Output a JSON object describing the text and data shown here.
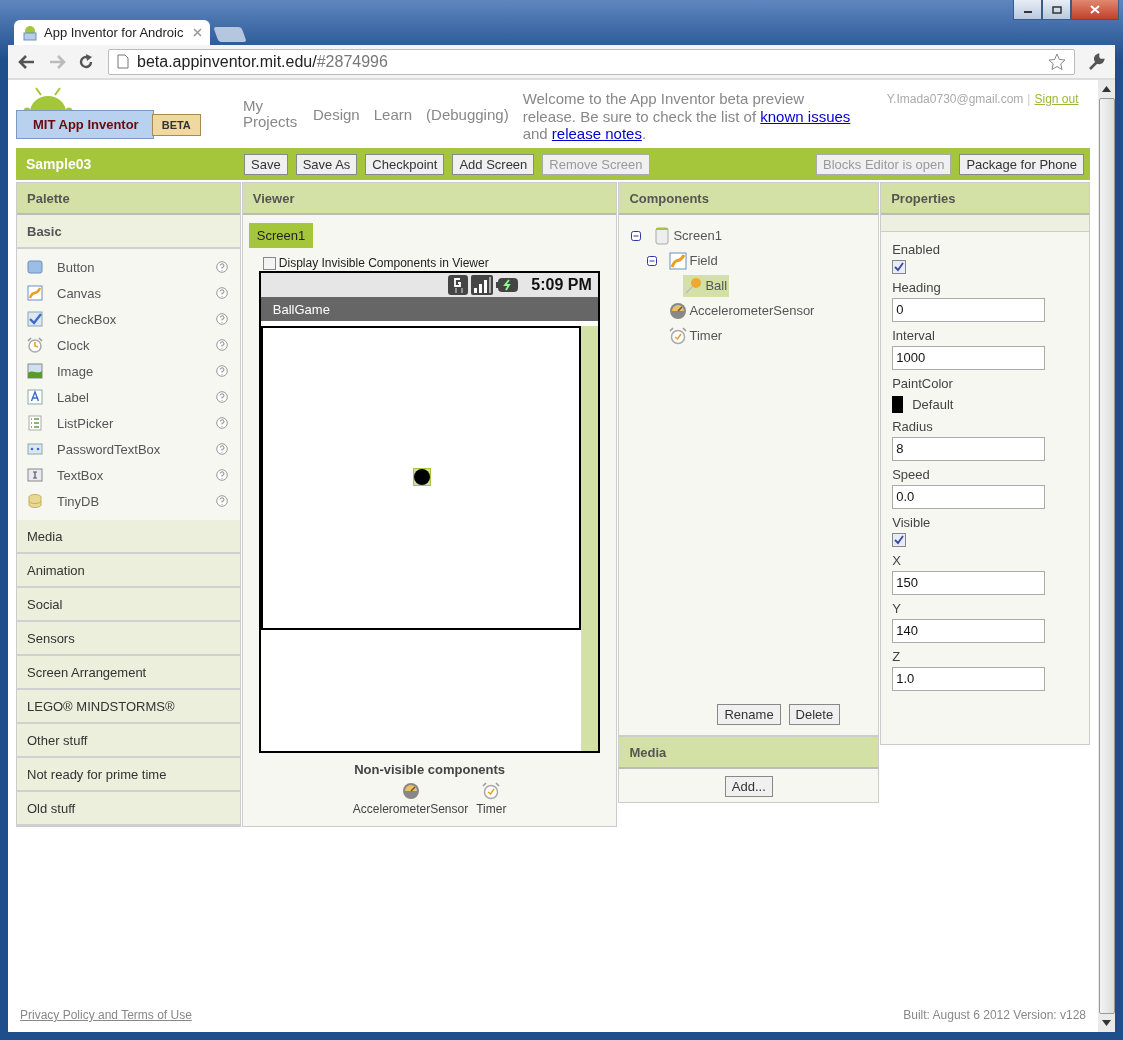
{
  "browser": {
    "tab_title": "App Inventor for Androic",
    "url_host": "beta.appinventor.mit.edu/",
    "url_path": "#2874996"
  },
  "header": {
    "logo": {
      "title": "MIT App Inventor",
      "badge": "BETA"
    },
    "nav": [
      "My Projects",
      "Design",
      "Learn",
      "(Debugging)"
    ],
    "welcome": [
      {
        "kind": "text",
        "text": "Welcome to the App Inventor beta preview release. Be sure to check the list of "
      },
      {
        "kind": "link",
        "text": "known issues"
      },
      {
        "kind": "text",
        "text": " and "
      },
      {
        "kind": "link",
        "text": "release notes"
      },
      {
        "kind": "text",
        "text": "."
      }
    ],
    "account": {
      "email": "Y.Imada0730@gmail.com",
      "separator": "|",
      "sign_out": "Sign out"
    }
  },
  "toolbar": {
    "project": "Sample03",
    "buttons": [
      {
        "label": "Save",
        "disabled": false
      },
      {
        "label": "Save As",
        "disabled": false
      },
      {
        "label": "Checkpoint",
        "disabled": false
      },
      {
        "label": "Add Screen",
        "disabled": false
      },
      {
        "label": "Remove Screen",
        "disabled": true
      }
    ],
    "right_buttons": [
      {
        "label": "Blocks Editor is open",
        "disabled": true
      },
      {
        "label": "Package for Phone",
        "disabled": false
      }
    ]
  },
  "palette": {
    "title": "Palette",
    "sections": [
      {
        "label": "Basic",
        "expanded": true,
        "items": [
          {
            "label": "Button",
            "kind": "button"
          },
          {
            "label": "Canvas",
            "kind": "canvas"
          },
          {
            "label": "CheckBox",
            "kind": "checkbox"
          },
          {
            "label": "Clock",
            "kind": "clock"
          },
          {
            "label": "Image",
            "kind": "image"
          },
          {
            "label": "Label",
            "kind": "label"
          },
          {
            "label": "ListPicker",
            "kind": "listpicker"
          },
          {
            "label": "PasswordTextBox",
            "kind": "password"
          },
          {
            "label": "TextBox",
            "kind": "textbox"
          },
          {
            "label": "TinyDB",
            "kind": "db"
          }
        ]
      },
      {
        "label": "Media",
        "expanded": false
      },
      {
        "label": "Animation",
        "expanded": false
      },
      {
        "label": "Social",
        "expanded": false
      },
      {
        "label": "Sensors",
        "expanded": false
      },
      {
        "label": "Screen Arrangement",
        "expanded": false
      },
      {
        "label": "LEGO® MINDSTORMS®",
        "expanded": false
      },
      {
        "label": "Other stuff",
        "expanded": false
      },
      {
        "label": "Not ready for prime time",
        "expanded": false
      },
      {
        "label": "Old stuff",
        "expanded": false
      }
    ]
  },
  "viewer": {
    "title": "Viewer",
    "screen_tab": "Screen1",
    "show_invisible": {
      "label": "Display Invisible Components in Viewer",
      "checked": false
    },
    "phone": {
      "time": "5:09 PM",
      "app_title": "BallGame"
    },
    "nonvisible": {
      "title": "Non-visible components",
      "items": [
        {
          "label": "AccelerometerSensor",
          "kind": "sensor"
        },
        {
          "label": "Timer",
          "kind": "clock"
        }
      ]
    }
  },
  "components": {
    "title": "Components",
    "tree": [
      {
        "label": "Screen1",
        "kind": "screen",
        "selected": false,
        "expanded": true,
        "children": [
          {
            "label": "Field",
            "kind": "canvas",
            "selected": false,
            "expanded": true,
            "children": [
              {
                "label": "Ball",
                "kind": "ball",
                "selected": true
              }
            ]
          },
          {
            "label": "AccelerometerSensor",
            "kind": "sensor",
            "selected": false
          },
          {
            "label": "Timer",
            "kind": "clock",
            "selected": false
          }
        ]
      }
    ],
    "buttons": [
      "Rename",
      "Delete"
    ]
  },
  "media": {
    "title": "Media",
    "button": "Add..."
  },
  "properties": {
    "title": "Properties",
    "items": [
      {
        "label": "Enabled",
        "kind": "checkbox",
        "checked": true
      },
      {
        "label": "Heading",
        "kind": "text",
        "value": "0"
      },
      {
        "label": "Interval",
        "kind": "text",
        "value": "1000"
      },
      {
        "label": "PaintColor",
        "kind": "color",
        "color": "#000000",
        "value": "Default"
      },
      {
        "label": "Radius",
        "kind": "text",
        "value": "8"
      },
      {
        "label": "Speed",
        "kind": "text",
        "value": "0.0"
      },
      {
        "label": "Visible",
        "kind": "checkbox",
        "checked": true
      },
      {
        "label": "X",
        "kind": "text",
        "value": "150"
      },
      {
        "label": "Y",
        "kind": "text",
        "value": "140"
      },
      {
        "label": "Z",
        "kind": "text",
        "value": "1.0"
      }
    ]
  },
  "footer": {
    "privacy": "Privacy Policy and Terms of Use",
    "build": "Built: August 6 2012 Version: v128"
  }
}
